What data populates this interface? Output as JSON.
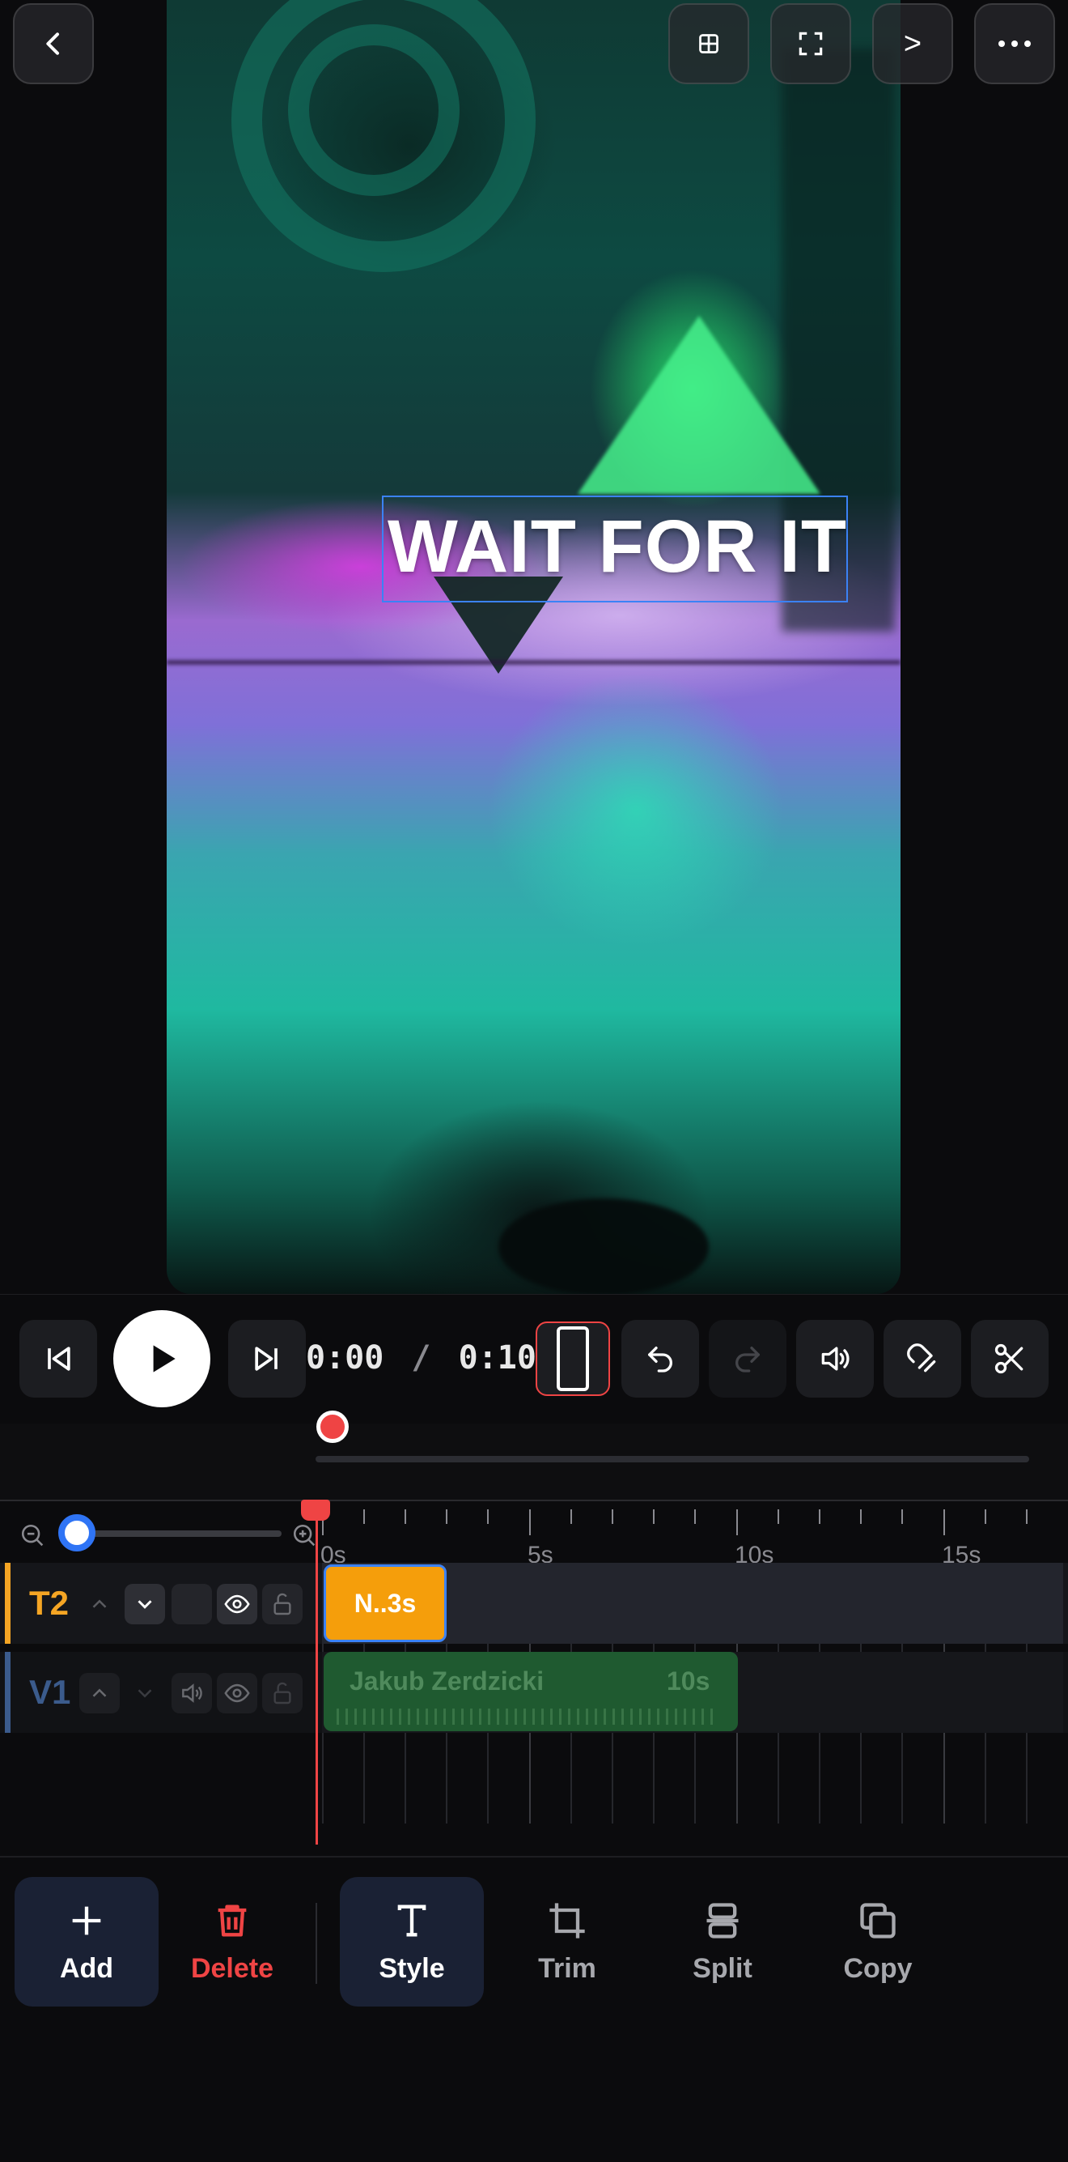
{
  "preview": {
    "overlay_text": "WAIT FOR IT"
  },
  "top_buttons": {
    "back_icon": "chevron-left-icon",
    "grid_icon": "grid-icon",
    "fullscreen_icon": "fullscreen-icon",
    "next_label": ">",
    "more_icon": "more-horizontal-icon"
  },
  "playback": {
    "current_time": "0:00",
    "separator": "/",
    "total_time": "0:10"
  },
  "timeline": {
    "ruler_labels": [
      "0s",
      "5s",
      "10s",
      "15s"
    ],
    "zoom_level": 0.05,
    "tracks": [
      {
        "id": "T2",
        "color": "#f5a524",
        "clip_label": "N..3s"
      },
      {
        "id": "V1",
        "color": "#3b5b8c",
        "clip_title": "Jakub Zerdzicki",
        "clip_duration": "10s"
      }
    ]
  },
  "toolbar": {
    "add": "Add",
    "delete": "Delete",
    "style": "Style",
    "trim": "Trim",
    "split": "Split",
    "copy": "Copy"
  },
  "colors": {
    "accent": "#3b82f6",
    "danger": "#ef4444",
    "text_clip": "#f59e0b",
    "video_clip": "#1f6e35"
  }
}
